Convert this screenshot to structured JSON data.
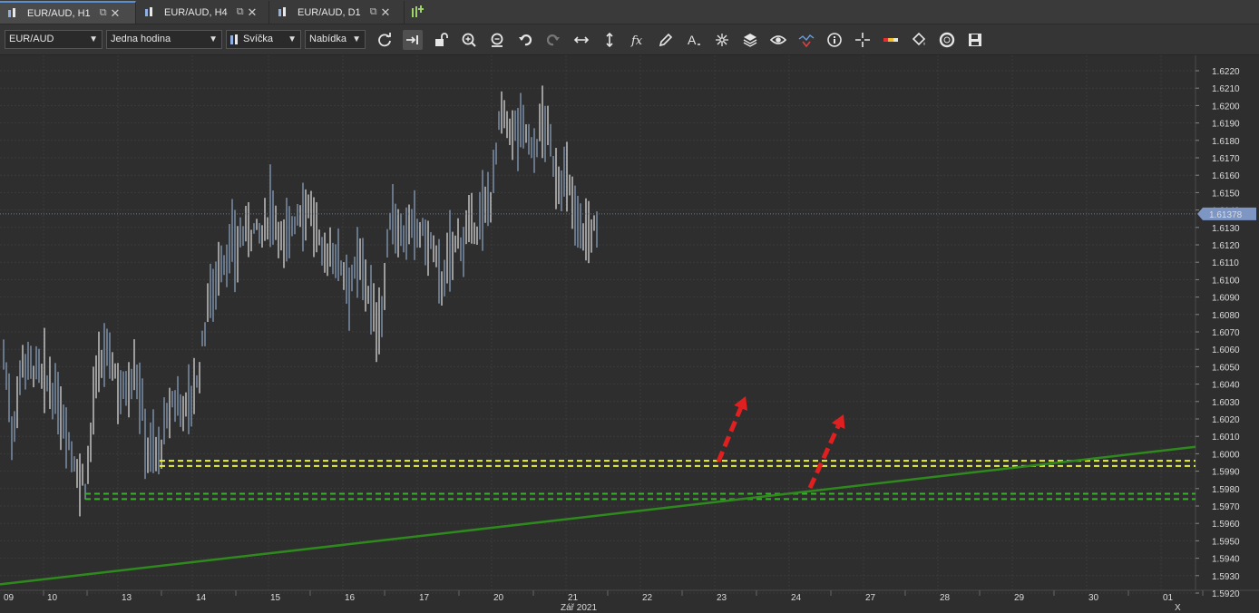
{
  "tabs": [
    {
      "label": "EUR/AUD, H1",
      "active": true
    },
    {
      "label": "EUR/AUD, H4",
      "active": false
    },
    {
      "label": "EUR/AUD, D1",
      "active": false
    }
  ],
  "toolbar": {
    "symbol": "EUR/AUD",
    "timeframe": "Jedna hodina",
    "chart_type": "Svíčka",
    "price_type": "Nabídka",
    "icons": [
      "refresh-icon",
      "auto-scroll-icon",
      "unlock-icon",
      "zoom-in-icon",
      "zoom-out-icon",
      "undo-icon",
      "redo-icon",
      "horizontal-resize-icon",
      "vertical-resize-icon",
      "fx-icon",
      "pencil-icon",
      "text-icon",
      "crosshair-star-icon",
      "layers-icon",
      "eye-icon",
      "alert-icon",
      "info-icon",
      "cursor-icon",
      "color-bar-icon",
      "paint-bucket-icon",
      "lifebuoy-icon",
      "save-icon"
    ]
  },
  "chart_data": {
    "type": "bar",
    "symbol": "EUR/AUD",
    "timeframe": "H1",
    "current_price": "1.61378",
    "ylim": [
      1.592,
      1.6225
    ],
    "y_ticks": [
      "1.6220",
      "1.6210",
      "1.6200",
      "1.6190",
      "1.6180",
      "1.6170",
      "1.6160",
      "1.6150",
      "1.6140",
      "1.6130",
      "1.6120",
      "1.6110",
      "1.6100",
      "1.6090",
      "1.6080",
      "1.6070",
      "1.6060",
      "1.6050",
      "1.6040",
      "1.6030",
      "1.6020",
      "1.6010",
      "1.6000",
      "1.5990",
      "1.5980",
      "1.5970",
      "1.5960",
      "1.5950",
      "1.5940",
      "1.5930",
      "1.5920"
    ],
    "x_ticks": [
      "09",
      "10",
      "13",
      "14",
      "15",
      "16",
      "17",
      "20",
      "21",
      "22",
      "23",
      "24",
      "27",
      "28",
      "29",
      "30",
      "01"
    ],
    "x_subtitle": "Zář 2021",
    "x_extra": "X",
    "support_zones": [
      {
        "color": "#e8f03a",
        "upper": 1.5996,
        "lower": 1.5993
      },
      {
        "color": "#3cae2e",
        "upper": 1.5977,
        "lower": 1.5974
      }
    ],
    "trendline": {
      "color": "#2f8a1e",
      "from": 1.5925,
      "to": 1.6004
    },
    "arrows_color": "#e02020"
  }
}
